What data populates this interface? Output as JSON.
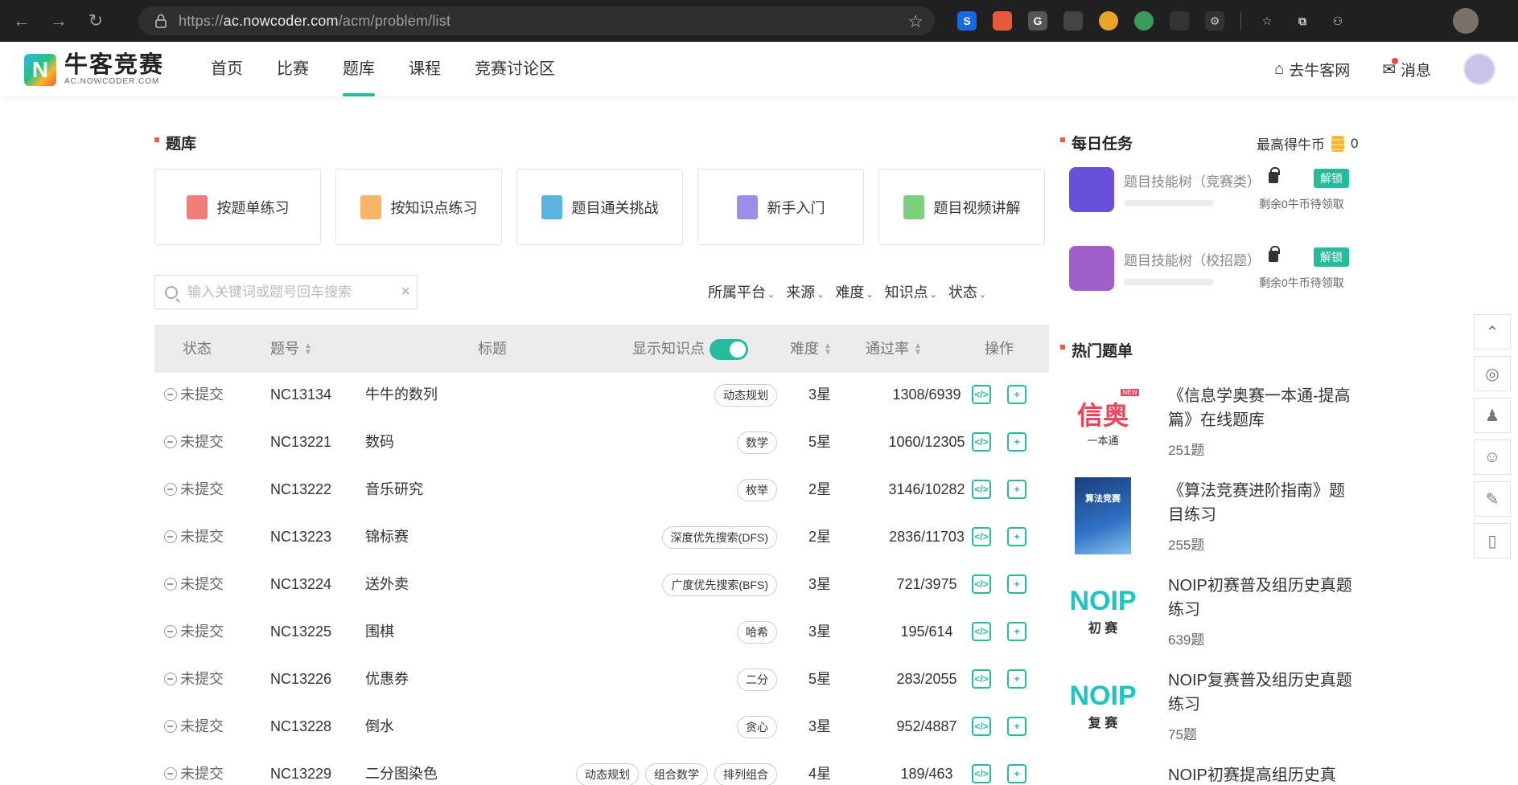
{
  "browser": {
    "url_prefix": "https://",
    "url_host": "ac.nowcoder.com",
    "url_path": "/acm/problem/list"
  },
  "site": {
    "logo_cn": "牛客竞赛",
    "logo_en": "AC.NOWCODER.COM",
    "nav": [
      "首页",
      "比赛",
      "题库",
      "课程",
      "竞赛讨论区"
    ],
    "active_nav": "题库",
    "go_main": "去牛客网",
    "messages": "消息"
  },
  "library": {
    "title": "题库",
    "cards": [
      {
        "label": "按题单练习",
        "color": "#f27c7c"
      },
      {
        "label": "按知识点练习",
        "color": "#f7b56a"
      },
      {
        "label": "题目通关挑战",
        "color": "#5bb3e0"
      },
      {
        "label": "新手入门",
        "color": "#9b8de8"
      },
      {
        "label": "题目视频讲解",
        "color": "#7ccf7c"
      }
    ],
    "search_placeholder": "输入关键词或题号回车搜索",
    "filters": [
      "所属平台",
      "来源",
      "难度",
      "知识点",
      "状态"
    ]
  },
  "table": {
    "headers": {
      "status": "状态",
      "id": "题号",
      "title": "标题",
      "show_tags": "显示知识点",
      "difficulty": "难度",
      "pass_rate": "通过率",
      "actions": "操作"
    },
    "show_tags_on": true,
    "rows": [
      {
        "status": "未提交",
        "id": "NC13134",
        "title": "牛牛的数列",
        "tags": [
          "动态规划"
        ],
        "difficulty": "3星",
        "pass": "1308/6939"
      },
      {
        "status": "未提交",
        "id": "NC13221",
        "title": "数码",
        "tags": [
          "数学"
        ],
        "difficulty": "5星",
        "pass": "1060/12305"
      },
      {
        "status": "未提交",
        "id": "NC13222",
        "title": "音乐研究",
        "tags": [
          "枚举"
        ],
        "difficulty": "2星",
        "pass": "3146/10282"
      },
      {
        "status": "未提交",
        "id": "NC13223",
        "title": "锦标赛",
        "tags": [
          "深度优先搜索(DFS)"
        ],
        "difficulty": "2星",
        "pass": "2836/11703"
      },
      {
        "status": "未提交",
        "id": "NC13224",
        "title": "送外卖",
        "tags": [
          "广度优先搜索(BFS)"
        ],
        "difficulty": "3星",
        "pass": "721/3975"
      },
      {
        "status": "未提交",
        "id": "NC13225",
        "title": "围棋",
        "tags": [
          "哈希"
        ],
        "difficulty": "3星",
        "pass": "195/614"
      },
      {
        "status": "未提交",
        "id": "NC13226",
        "title": "优惠券",
        "tags": [
          "二分"
        ],
        "difficulty": "5星",
        "pass": "283/2055"
      },
      {
        "status": "未提交",
        "id": "NC13228",
        "title": "倒水",
        "tags": [
          "贪心"
        ],
        "difficulty": "3星",
        "pass": "952/4887"
      },
      {
        "status": "未提交",
        "id": "NC13229",
        "title": "二分图染色",
        "tags": [
          "动态规划",
          "组合数学",
          "排列组合"
        ],
        "difficulty": "4星",
        "pass": "189/463"
      }
    ]
  },
  "daily": {
    "title": "每日任务",
    "max_coins_label": "最高得牛币",
    "max_coins": "0",
    "tasks": [
      {
        "title": "题目技能树（竞赛类）",
        "unlock": "解锁",
        "remain": "剩余0牛币待领取",
        "color": "#6a4fd8"
      },
      {
        "title": "题目技能树（校招题）",
        "unlock": "解锁",
        "remain": "剩余0牛币待领取",
        "color": "#a05fc8"
      }
    ]
  },
  "hot": {
    "title": "热门题单",
    "items": [
      {
        "title": "《信息学奥赛一本通-提高篇》在线题库",
        "count": "251题",
        "cover_main": "信奥",
        "cover_sub": "一本通",
        "cover_badge": "NEW"
      },
      {
        "title": "《算法竞赛进阶指南》题目练习",
        "count": "255题",
        "cover_main": "算法竞赛",
        "cover_sub": ""
      },
      {
        "title": "NOIP初赛普及组历史真题练习",
        "count": "639题",
        "cover_main": "NOIP",
        "cover_sub": "初 赛"
      },
      {
        "title": "NOIP复赛普及组历史真题练习",
        "count": "75题",
        "cover_main": "NOIP",
        "cover_sub": "复 赛"
      },
      {
        "title": "NOIP初赛提高组历史真",
        "count": "",
        "cover_main": "",
        "cover_sub": ""
      }
    ]
  }
}
